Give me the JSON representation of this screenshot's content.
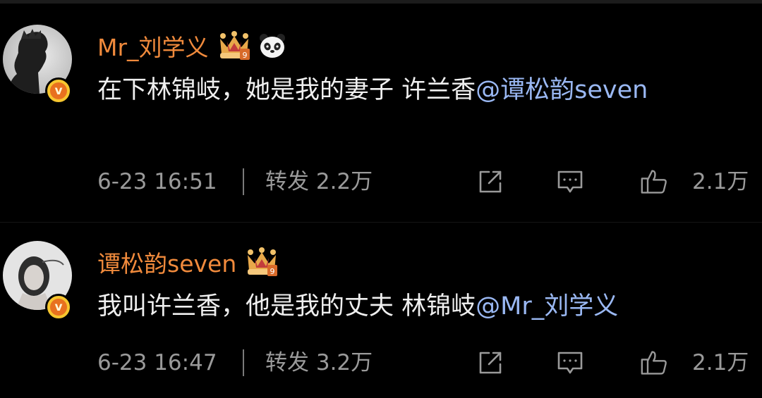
{
  "posts": [
    {
      "username": "Mr_刘学义",
      "verified_badge": "v",
      "badge_icons": [
        "crown-level-icon",
        "panda-icon"
      ],
      "text": "在下林锦岐，她是我的妻子 许兰香",
      "mention": "@谭松韵seven",
      "time": "6-23 16:51",
      "repost_label": "转发",
      "repost_count": "2.2万",
      "like_count": "2.1万"
    },
    {
      "username": "谭松韵seven",
      "verified_badge": "v",
      "badge_icons": [
        "crown-level-icon"
      ],
      "text": "我叫许兰香，他是我的丈夫 林锦岐",
      "mention": "@Mr_刘学义",
      "time": "6-23 16:47",
      "repost_label": "转发",
      "repost_count": "3.2万",
      "like_count": "2.1万"
    }
  ],
  "colors": {
    "background": "#000000",
    "username": "#f08a3c",
    "mention": "#9ab8f3",
    "meta_text": "#9a9a9a",
    "badge": "#f7c62f"
  }
}
